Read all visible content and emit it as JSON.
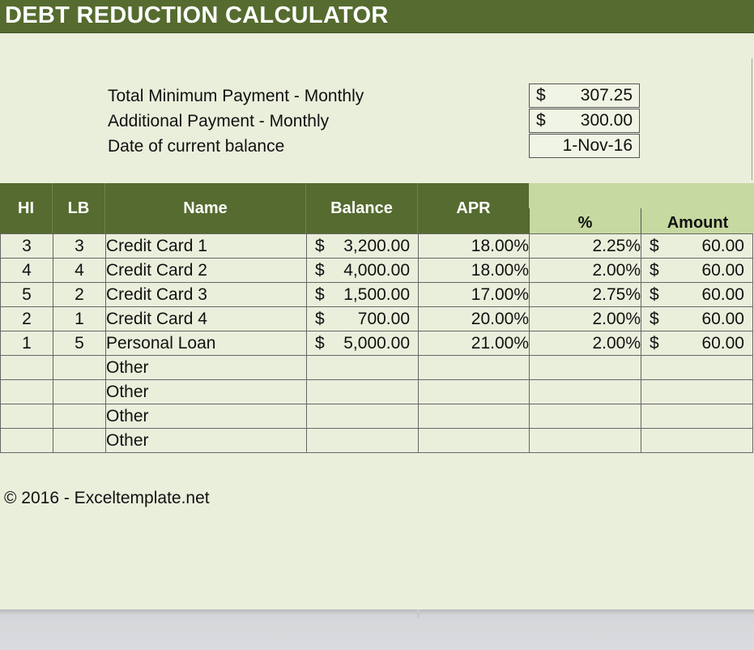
{
  "title": "DEBT REDUCTION CALCULATOR",
  "summary": [
    {
      "label": "Total Minimum Payment - Monthly",
      "currency": "$",
      "value": "307.25"
    },
    {
      "label": "Additional Payment - Monthly",
      "currency": "$",
      "value": "300.00"
    },
    {
      "label": "Date of current balance",
      "currency": "",
      "value": "1-Nov-16"
    }
  ],
  "headers": {
    "hi": "HI",
    "lb": "LB",
    "name": "Name",
    "balance": "Balance",
    "apr": "APR",
    "pct": "%",
    "amount": "Amount"
  },
  "rows": [
    {
      "hi": "3",
      "lb": "3",
      "name": "Credit Card 1",
      "bal_cur": "$",
      "balance": "3,200.00",
      "apr": "18.00%",
      "pct": "2.25%",
      "amt_cur": "$",
      "amount": "60.00"
    },
    {
      "hi": "4",
      "lb": "4",
      "name": "Credit Card 2",
      "bal_cur": "$",
      "balance": "4,000.00",
      "apr": "18.00%",
      "pct": "2.00%",
      "amt_cur": "$",
      "amount": "60.00"
    },
    {
      "hi": "5",
      "lb": "2",
      "name": "Credit Card 3",
      "bal_cur": "$",
      "balance": "1,500.00",
      "apr": "17.00%",
      "pct": "2.75%",
      "amt_cur": "$",
      "amount": "60.00"
    },
    {
      "hi": "2",
      "lb": "1",
      "name": "Credit Card 4",
      "bal_cur": "$",
      "balance": "700.00",
      "apr": "20.00%",
      "pct": "2.00%",
      "amt_cur": "$",
      "amount": "60.00"
    },
    {
      "hi": "1",
      "lb": "5",
      "name": "Personal Loan",
      "bal_cur": "$",
      "balance": "5,000.00",
      "apr": "21.00%",
      "pct": "2.00%",
      "amt_cur": "$",
      "amount": "60.00"
    },
    {
      "hi": "",
      "lb": "",
      "name": "Other",
      "bal_cur": "",
      "balance": "",
      "apr": "",
      "pct": "",
      "amt_cur": "",
      "amount": ""
    },
    {
      "hi": "",
      "lb": "",
      "name": "Other",
      "bal_cur": "",
      "balance": "",
      "apr": "",
      "pct": "",
      "amt_cur": "",
      "amount": ""
    },
    {
      "hi": "",
      "lb": "",
      "name": "Other",
      "bal_cur": "",
      "balance": "",
      "apr": "",
      "pct": "",
      "amt_cur": "",
      "amount": ""
    },
    {
      "hi": "",
      "lb": "",
      "name": "Other",
      "bal_cur": "",
      "balance": "",
      "apr": "",
      "pct": "",
      "amt_cur": "",
      "amount": ""
    }
  ],
  "footer": {
    "copyright": "© 2016 - Exceltemplate.net"
  },
  "colors": {
    "header_green": "#556b2f",
    "subheader_green": "#c6d9a0",
    "sheet_bg": "#eaefdc"
  }
}
